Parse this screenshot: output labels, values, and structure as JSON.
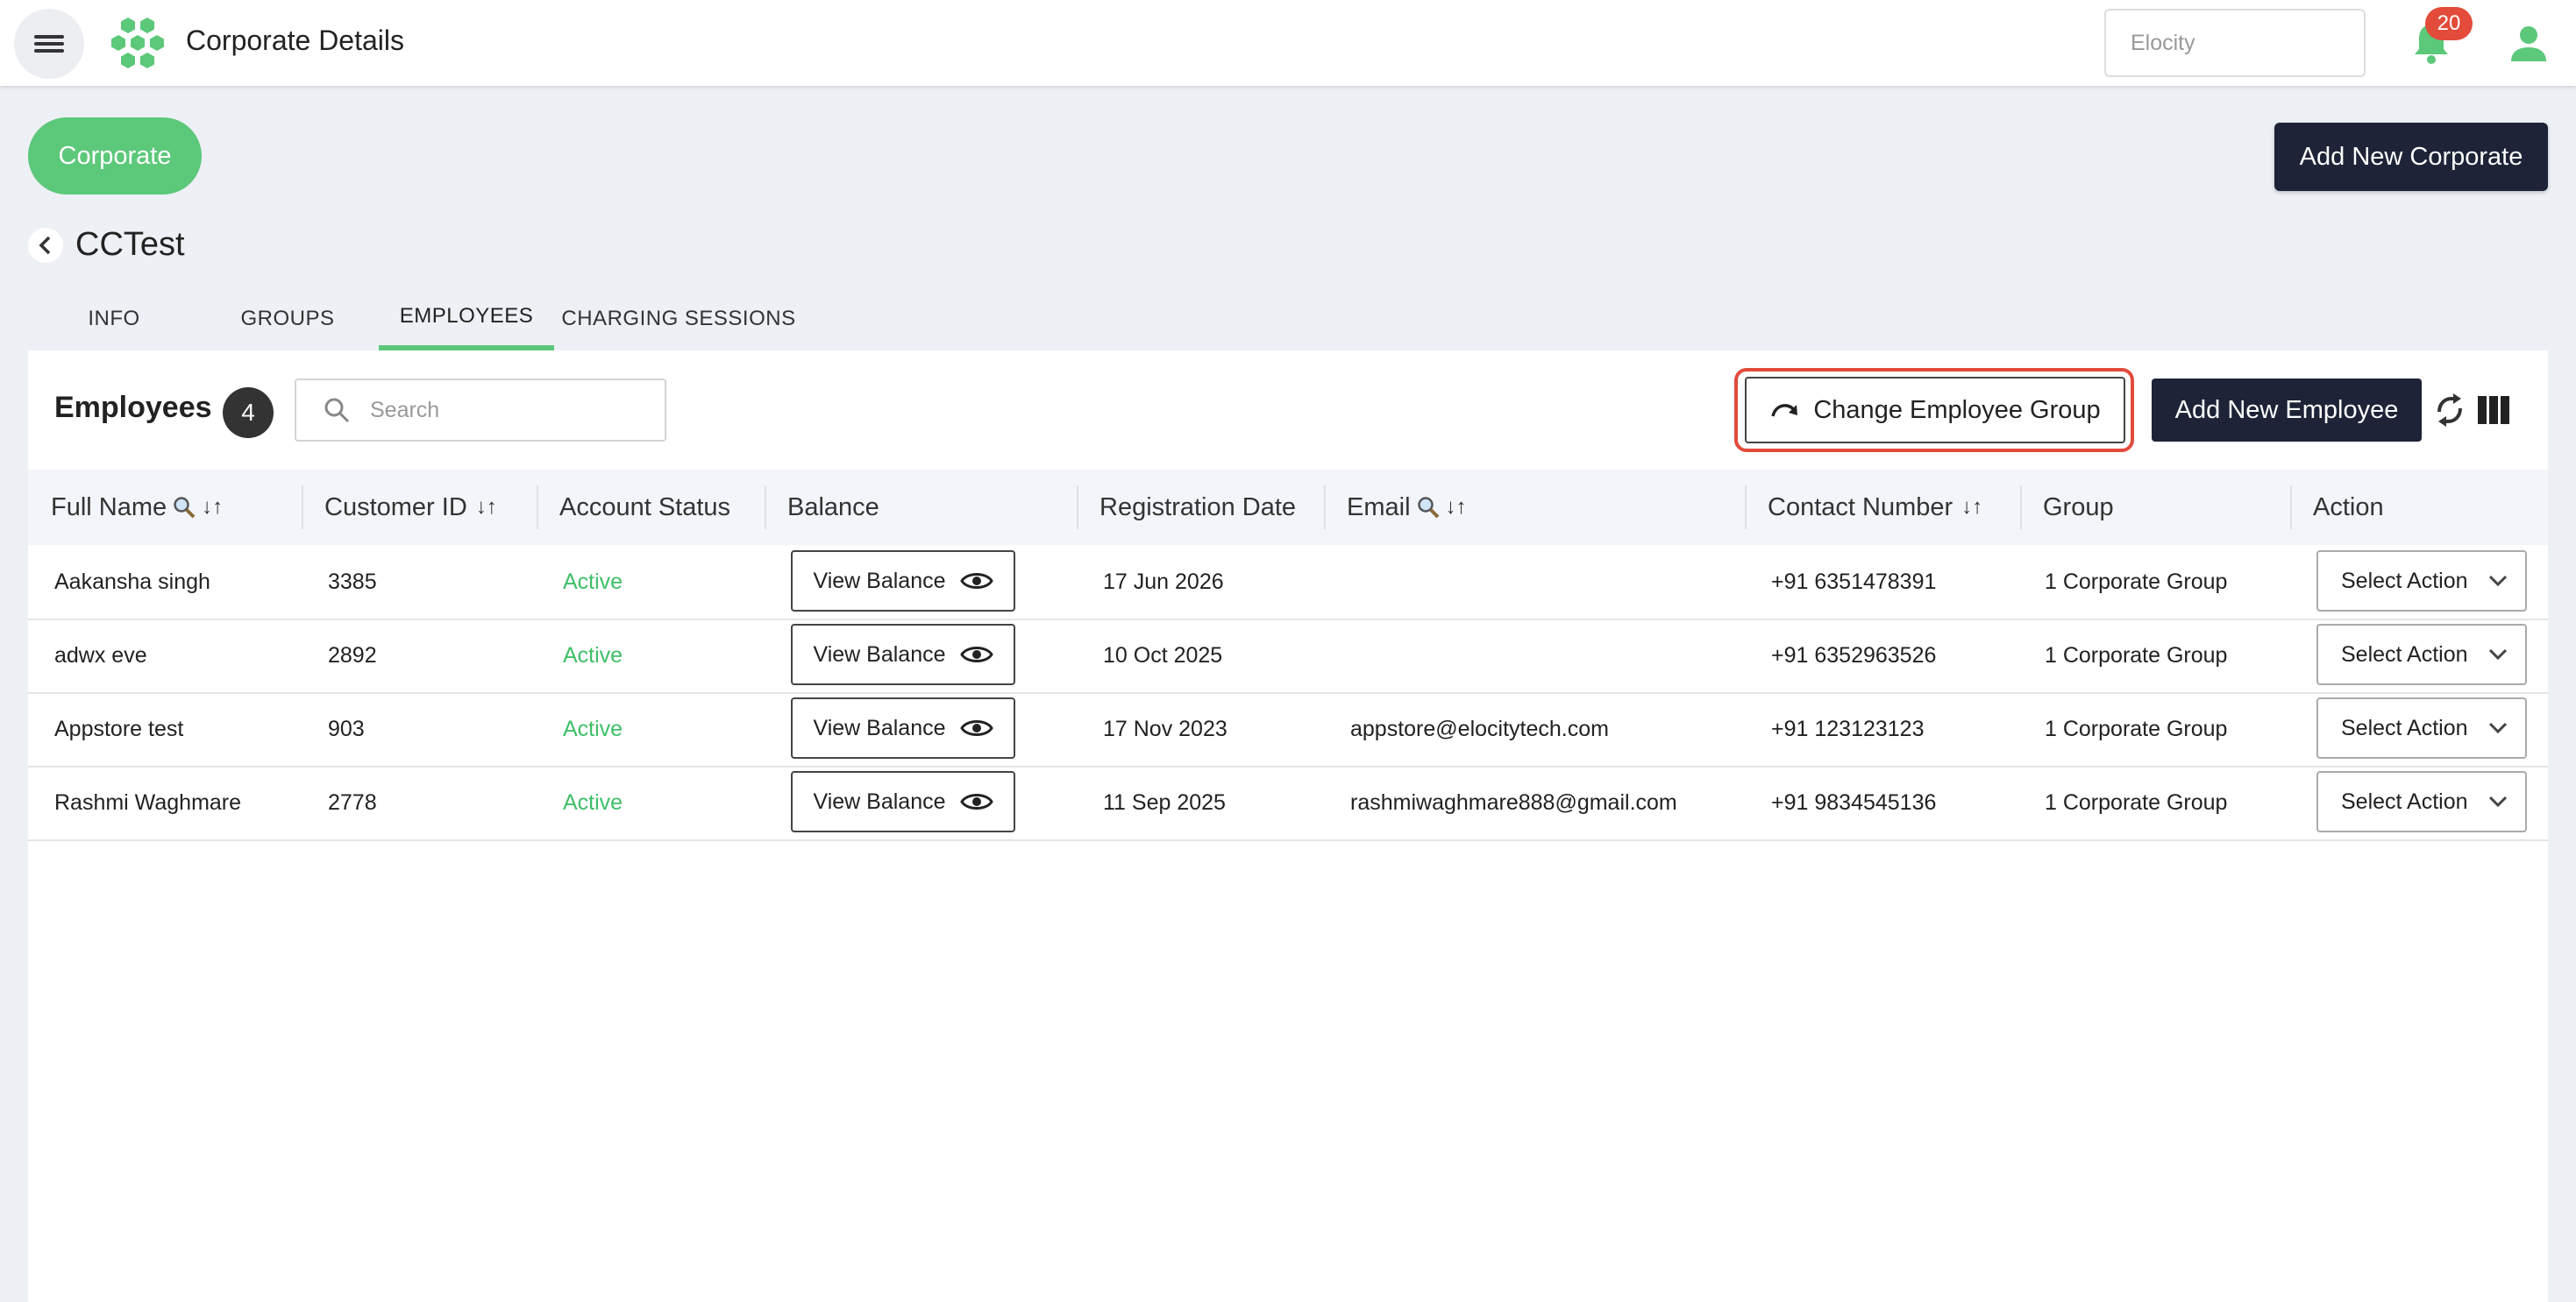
{
  "header": {
    "app_title": "Corporate Details",
    "org_selector_value": "Elocity",
    "notification_count": "20",
    "icons": [
      "menu-icon",
      "honeycomb-logo",
      "bell-icon",
      "user-icon"
    ]
  },
  "page": {
    "corporate_button": "Corporate",
    "add_corporate_button": "Add New Corporate",
    "corporate_name": "CCTest"
  },
  "tabs": [
    {
      "label": "INFO",
      "active": false
    },
    {
      "label": "GROUPS",
      "active": false
    },
    {
      "label": "EMPLOYEES",
      "active": true
    },
    {
      "label": "CHARGING SESSIONS",
      "active": false
    }
  ],
  "employees": {
    "title": "Employees",
    "count": "4",
    "search_placeholder": "Search",
    "change_group_button": "Change Employee Group",
    "add_employee_button": "Add New Employee"
  },
  "table": {
    "columns": {
      "full_name": "Full Name",
      "customer_id": "Customer ID",
      "account_status": "Account Status",
      "balance": "Balance",
      "registration_date": "Registration Date",
      "email": "Email",
      "contact_number": "Contact Number",
      "group": "Group",
      "action": "Action"
    },
    "sort_glyph": "↓↑",
    "view_balance_label": "View Balance",
    "select_action_label": "Select Action",
    "rows": [
      {
        "name": "Aakansha singh",
        "customer_id": "3385",
        "status": "Active",
        "date": "17 Jun 2026",
        "email": "",
        "contact": "+91 6351478391",
        "group": "1 Corporate Group"
      },
      {
        "name": "adwx eve",
        "customer_id": "2892",
        "status": "Active",
        "date": "10 Oct 2025",
        "email": "",
        "contact": "+91 6352963526",
        "group": "1 Corporate Group"
      },
      {
        "name": "Appstore test",
        "customer_id": "903",
        "status": "Active",
        "date": "17 Nov 2023",
        "email": "appstore@elocitytech.com",
        "contact": "+91 123123123",
        "group": "1 Corporate Group"
      },
      {
        "name": "Rashmi Waghmare",
        "customer_id": "2778",
        "status": "Active",
        "date": "11 Sep 2025",
        "email": "rashmiwaghmare888@gmail.com",
        "contact": "+91 9834545136",
        "group": "1 Corporate Group"
      }
    ]
  },
  "colors": {
    "accent_green": "#5cc87a",
    "status_active": "#3fbf68",
    "dark_button": "#1e2337",
    "highlight_red": "#e24a3b",
    "badge_red": "#e34b3a"
  }
}
